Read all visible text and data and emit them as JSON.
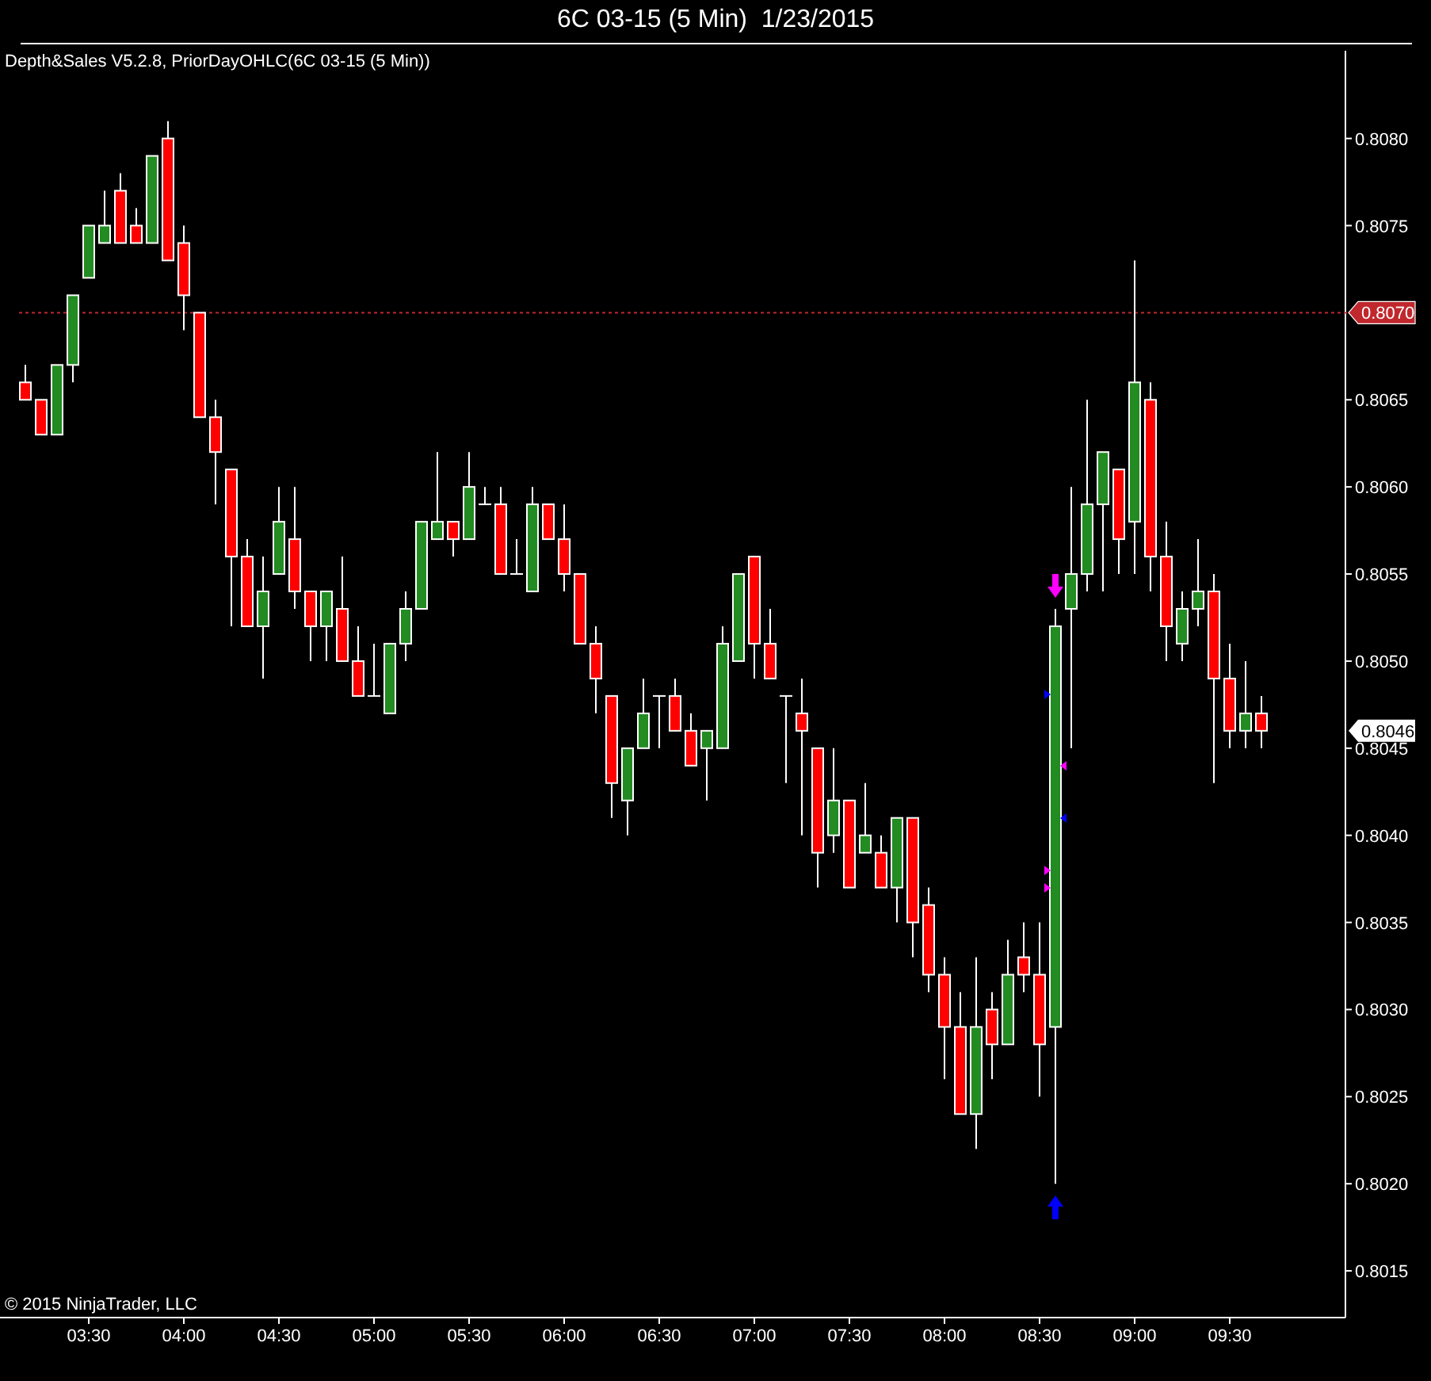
{
  "window": {
    "title": "6C 03-15 (5 Min)  1/23/2015"
  },
  "chart": {
    "indicator_label": "Depth&Sales V5.2.8, PriorDayOHLC(6C 03-15 (5 Min))",
    "copyright": "© 2015 NinjaTrader, LLC",
    "last_price_tag": "0.8046",
    "chart_data": {
      "type": "candlestick",
      "x": [
        190,
        195,
        200,
        205,
        210,
        215,
        220,
        225,
        230,
        235,
        240,
        245,
        250,
        255,
        260,
        265,
        270,
        275,
        280,
        285,
        290,
        295,
        300,
        305,
        310,
        315,
        320,
        325,
        330,
        335,
        340,
        345,
        350,
        355,
        360,
        365,
        370,
        375,
        380,
        385,
        390,
        395,
        400,
        405,
        410,
        415,
        420,
        425,
        430,
        435,
        440,
        445,
        450,
        455,
        460,
        465,
        470,
        475,
        480,
        485,
        490,
        495,
        500,
        505,
        510,
        515,
        520,
        525,
        530,
        535,
        540,
        545,
        550,
        555,
        560,
        565,
        570,
        575,
        580
      ],
      "ohlc": [
        [
          0.8066,
          0.8067,
          0.8065,
          0.8065
        ],
        [
          0.8065,
          0.8065,
          0.8063,
          0.8063
        ],
        [
          0.8063,
          0.8067,
          0.8063,
          0.8067
        ],
        [
          0.8067,
          0.8071,
          0.8066,
          0.8071
        ],
        [
          0.8072,
          0.8075,
          0.8072,
          0.8075
        ],
        [
          0.8074,
          0.8077,
          0.8074,
          0.8075
        ],
        [
          0.8077,
          0.8078,
          0.8074,
          0.8074
        ],
        [
          0.8075,
          0.8076,
          0.8074,
          0.8074
        ],
        [
          0.8074,
          0.8079,
          0.8074,
          0.8079
        ],
        [
          0.808,
          0.8081,
          0.8073,
          0.8073
        ],
        [
          0.8074,
          0.8075,
          0.8069,
          0.8071
        ],
        [
          0.807,
          0.807,
          0.8064,
          0.8064
        ],
        [
          0.8064,
          0.8065,
          0.8059,
          0.8062
        ],
        [
          0.8061,
          0.8061,
          0.8052,
          0.8056
        ],
        [
          0.8056,
          0.8057,
          0.8052,
          0.8052
        ],
        [
          0.8052,
          0.8056,
          0.8049,
          0.8054
        ],
        [
          0.8055,
          0.806,
          0.8055,
          0.8058
        ],
        [
          0.8057,
          0.806,
          0.8053,
          0.8054
        ],
        [
          0.8054,
          0.8054,
          0.805,
          0.8052
        ],
        [
          0.8052,
          0.8054,
          0.805,
          0.8054
        ],
        [
          0.8053,
          0.8056,
          0.805,
          0.805
        ],
        [
          0.805,
          0.8052,
          0.8048,
          0.8048
        ],
        [
          0.8048,
          0.8051,
          0.8048,
          0.8048
        ],
        [
          0.8047,
          0.8051,
          0.8047,
          0.8051
        ],
        [
          0.8051,
          0.8054,
          0.805,
          0.8053
        ],
        [
          0.8053,
          0.8058,
          0.8053,
          0.8058
        ],
        [
          0.8057,
          0.8062,
          0.8057,
          0.8058
        ],
        [
          0.8058,
          0.8058,
          0.8056,
          0.8057
        ],
        [
          0.8057,
          0.8062,
          0.8057,
          0.806
        ],
        [
          0.8059,
          0.806,
          0.8059,
          0.8059
        ],
        [
          0.8059,
          0.806,
          0.8055,
          0.8055
        ],
        [
          0.8055,
          0.8057,
          0.8055,
          0.8055
        ],
        [
          0.8054,
          0.806,
          0.8054,
          0.8059
        ],
        [
          0.8059,
          0.8059,
          0.8057,
          0.8057
        ],
        [
          0.8057,
          0.8059,
          0.8054,
          0.8055
        ],
        [
          0.8055,
          0.8055,
          0.8051,
          0.8051
        ],
        [
          0.8051,
          0.8052,
          0.8047,
          0.8049
        ],
        [
          0.8048,
          0.8048,
          0.8041,
          0.8043
        ],
        [
          0.8042,
          0.8045,
          0.804,
          0.8045
        ],
        [
          0.8045,
          0.8049,
          0.8045,
          0.8047
        ],
        [
          0.8048,
          0.8048,
          0.8045,
          0.8048
        ],
        [
          0.8048,
          0.8049,
          0.8046,
          0.8046
        ],
        [
          0.8046,
          0.8047,
          0.8044,
          0.8044
        ],
        [
          0.8045,
          0.8046,
          0.8042,
          0.8046
        ],
        [
          0.8045,
          0.8052,
          0.8045,
          0.8051
        ],
        [
          0.805,
          0.8055,
          0.805,
          0.8055
        ],
        [
          0.8056,
          0.8056,
          0.8049,
          0.8051
        ],
        [
          0.8051,
          0.8053,
          0.8049,
          0.8049
        ],
        [
          0.8048,
          0.8048,
          0.8043,
          0.8048
        ],
        [
          0.8047,
          0.8049,
          0.804,
          0.8046
        ],
        [
          0.8045,
          0.8045,
          0.8037,
          0.8039
        ],
        [
          0.804,
          0.8045,
          0.8039,
          0.8042
        ],
        [
          0.8042,
          0.8042,
          0.8037,
          0.8037
        ],
        [
          0.8039,
          0.8043,
          0.8039,
          0.804
        ],
        [
          0.8039,
          0.804,
          0.8037,
          0.8037
        ],
        [
          0.8037,
          0.8041,
          0.8035,
          0.8041
        ],
        [
          0.8041,
          0.8041,
          0.8033,
          0.8035
        ],
        [
          0.8036,
          0.8037,
          0.8031,
          0.8032
        ],
        [
          0.8032,
          0.8033,
          0.8026,
          0.8029
        ],
        [
          0.8029,
          0.8031,
          0.8024,
          0.8024
        ],
        [
          0.8024,
          0.8033,
          0.8022,
          0.8029
        ],
        [
          0.803,
          0.8031,
          0.8026,
          0.8028
        ],
        [
          0.8028,
          0.8034,
          0.8028,
          0.8032
        ],
        [
          0.8033,
          0.8035,
          0.8031,
          0.8032
        ],
        [
          0.8032,
          0.8035,
          0.8025,
          0.8028
        ],
        [
          0.8029,
          0.8053,
          0.802,
          0.8052
        ],
        [
          0.8053,
          0.806,
          0.8045,
          0.8055
        ],
        [
          0.8055,
          0.8065,
          0.8054,
          0.8059
        ],
        [
          0.8059,
          0.8062,
          0.8054,
          0.8062
        ],
        [
          0.8061,
          0.8061,
          0.8055,
          0.8057
        ],
        [
          0.8058,
          0.8073,
          0.8055,
          0.8066
        ],
        [
          0.8065,
          0.8066,
          0.8054,
          0.8056
        ],
        [
          0.8056,
          0.8058,
          0.805,
          0.8052
        ],
        [
          0.8051,
          0.8054,
          0.805,
          0.8053
        ],
        [
          0.8053,
          0.8057,
          0.8052,
          0.8054
        ],
        [
          0.8054,
          0.8055,
          0.8043,
          0.8049
        ],
        [
          0.8049,
          0.8051,
          0.8045,
          0.8046
        ],
        [
          0.8046,
          0.805,
          0.8045,
          0.8047
        ],
        [
          0.8047,
          0.8048,
          0.8045,
          0.8046
        ]
      ],
      "ylim": [
        0.80125,
        0.80854
      ],
      "xlim": [
        182,
        606.5
      ],
      "xticks": [
        {
          "value": 210,
          "label": "03:30"
        },
        {
          "value": 240,
          "label": "04:00"
        },
        {
          "value": 270,
          "label": "04:30"
        },
        {
          "value": 300,
          "label": "05:00"
        },
        {
          "value": 330,
          "label": "05:30"
        },
        {
          "value": 360,
          "label": "06:00"
        },
        {
          "value": 390,
          "label": "06:30"
        },
        {
          "value": 420,
          "label": "07:00"
        },
        {
          "value": 450,
          "label": "07:30"
        },
        {
          "value": 480,
          "label": "08:00"
        },
        {
          "value": 510,
          "label": "08:30"
        },
        {
          "value": 540,
          "label": "09:00"
        },
        {
          "value": 570,
          "label": "09:30"
        }
      ],
      "yticks": [
        {
          "value": 0.808,
          "label": "0.8080"
        },
        {
          "value": 0.8075,
          "label": "0.8075"
        },
        {
          "value": 0.8065,
          "label": "0.8065"
        },
        {
          "value": 0.806,
          "label": "0.8060"
        },
        {
          "value": 0.8055,
          "label": "0.8055"
        },
        {
          "value": 0.805,
          "label": "0.8050"
        },
        {
          "value": 0.8045,
          "label": "0.8045"
        },
        {
          "value": 0.804,
          "label": "0.8040"
        },
        {
          "value": 0.8035,
          "label": "0.8035"
        },
        {
          "value": 0.803,
          "label": "0.8030"
        },
        {
          "value": 0.8025,
          "label": "0.8025"
        },
        {
          "value": 0.802,
          "label": "0.8020"
        },
        {
          "value": 0.8015,
          "label": "0.8015"
        }
      ],
      "ref_lines": [
        {
          "axis": "y",
          "value": 0.807,
          "label": "0.8070",
          "color": "#c0282d"
        }
      ]
    }
  }
}
